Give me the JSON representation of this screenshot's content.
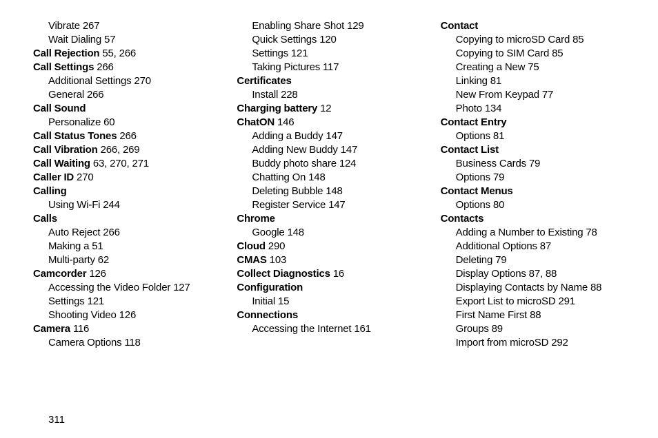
{
  "page_number": "311",
  "columns": [
    [
      {
        "level": 1,
        "bold": false,
        "text": "Vibrate",
        "pages": "267"
      },
      {
        "level": 1,
        "bold": false,
        "text": "Wait Dialing",
        "pages": "57"
      },
      {
        "level": 0,
        "bold": true,
        "text": "Call Rejection",
        "pages": "55, 266"
      },
      {
        "level": 0,
        "bold": true,
        "text": "Call Settings",
        "pages": "266"
      },
      {
        "level": 1,
        "bold": false,
        "text": "Additional Settings",
        "pages": "270"
      },
      {
        "level": 1,
        "bold": false,
        "text": "General",
        "pages": "266"
      },
      {
        "level": 0,
        "bold": true,
        "text": "Call Sound",
        "pages": ""
      },
      {
        "level": 1,
        "bold": false,
        "text": "Personalize",
        "pages": "60"
      },
      {
        "level": 0,
        "bold": true,
        "text": "Call Status Tones",
        "pages": "266"
      },
      {
        "level": 0,
        "bold": true,
        "text": "Call Vibration",
        "pages": "266, 269"
      },
      {
        "level": 0,
        "bold": true,
        "text": "Call Waiting",
        "pages": "63, 270, 271"
      },
      {
        "level": 0,
        "bold": true,
        "text": "Caller ID",
        "pages": "270"
      },
      {
        "level": 0,
        "bold": true,
        "text": "Calling",
        "pages": ""
      },
      {
        "level": 1,
        "bold": false,
        "text": "Using Wi-Fi",
        "pages": "244"
      },
      {
        "level": 0,
        "bold": true,
        "text": "Calls",
        "pages": ""
      },
      {
        "level": 1,
        "bold": false,
        "text": "Auto Reject",
        "pages": "266"
      },
      {
        "level": 1,
        "bold": false,
        "text": "Making a",
        "pages": "51"
      },
      {
        "level": 1,
        "bold": false,
        "text": "Multi-party",
        "pages": "62"
      },
      {
        "level": 0,
        "bold": true,
        "text": "Camcorder",
        "pages": "126"
      },
      {
        "level": 1,
        "bold": false,
        "text": "Accessing the Video Folder",
        "pages": "127"
      },
      {
        "level": 1,
        "bold": false,
        "text": "Settings",
        "pages": "121"
      },
      {
        "level": 1,
        "bold": false,
        "text": "Shooting Video",
        "pages": "126"
      },
      {
        "level": 0,
        "bold": true,
        "text": "Camera",
        "pages": "116"
      },
      {
        "level": 1,
        "bold": false,
        "text": "Camera Options",
        "pages": "118"
      }
    ],
    [
      {
        "level": 1,
        "bold": false,
        "text": "Enabling Share Shot",
        "pages": "129"
      },
      {
        "level": 1,
        "bold": false,
        "text": "Quick Settings",
        "pages": "120"
      },
      {
        "level": 1,
        "bold": false,
        "text": "Settings",
        "pages": "121"
      },
      {
        "level": 1,
        "bold": false,
        "text": "Taking Pictures",
        "pages": "117"
      },
      {
        "level": 0,
        "bold": true,
        "text": "Certificates",
        "pages": ""
      },
      {
        "level": 1,
        "bold": false,
        "text": "Install",
        "pages": "228"
      },
      {
        "level": 0,
        "bold": true,
        "text": "Charging battery",
        "pages": "12"
      },
      {
        "level": 0,
        "bold": true,
        "text": "ChatON",
        "pages": "146"
      },
      {
        "level": 1,
        "bold": false,
        "text": "Adding a Buddy",
        "pages": "147"
      },
      {
        "level": 1,
        "bold": false,
        "text": "Adding New Buddy",
        "pages": "147"
      },
      {
        "level": 1,
        "bold": false,
        "text": "Buddy photo share",
        "pages": "124"
      },
      {
        "level": 1,
        "bold": false,
        "text": "Chatting On",
        "pages": "148"
      },
      {
        "level": 1,
        "bold": false,
        "text": "Deleting Bubble",
        "pages": "148"
      },
      {
        "level": 1,
        "bold": false,
        "text": "Register Service",
        "pages": "147"
      },
      {
        "level": 0,
        "bold": true,
        "text": "Chrome",
        "pages": ""
      },
      {
        "level": 1,
        "bold": false,
        "text": "Google",
        "pages": "148"
      },
      {
        "level": 0,
        "bold": true,
        "text": "Cloud",
        "pages": "290"
      },
      {
        "level": 0,
        "bold": true,
        "text": "CMAS",
        "pages": "103"
      },
      {
        "level": 0,
        "bold": true,
        "text": "Collect Diagnostics",
        "pages": "16"
      },
      {
        "level": 0,
        "bold": true,
        "text": "Configuration",
        "pages": ""
      },
      {
        "level": 1,
        "bold": false,
        "text": "Initial",
        "pages": "15"
      },
      {
        "level": 0,
        "bold": true,
        "text": "Connections",
        "pages": ""
      },
      {
        "level": 1,
        "bold": false,
        "text": "Accessing the Internet",
        "pages": "161"
      }
    ],
    [
      {
        "level": 0,
        "bold": true,
        "text": "Contact",
        "pages": ""
      },
      {
        "level": 1,
        "bold": false,
        "text": "Copying to microSD Card",
        "pages": "85"
      },
      {
        "level": 1,
        "bold": false,
        "text": "Copying to SIM Card",
        "pages": "85"
      },
      {
        "level": 1,
        "bold": false,
        "text": "Creating a New",
        "pages": "75"
      },
      {
        "level": 1,
        "bold": false,
        "text": "Linking",
        "pages": "81"
      },
      {
        "level": 1,
        "bold": false,
        "text": "New From Keypad",
        "pages": "77"
      },
      {
        "level": 1,
        "bold": false,
        "text": "Photo",
        "pages": "134"
      },
      {
        "level": 0,
        "bold": true,
        "text": "Contact Entry",
        "pages": ""
      },
      {
        "level": 1,
        "bold": false,
        "text": "Options",
        "pages": "81"
      },
      {
        "level": 0,
        "bold": true,
        "text": "Contact List",
        "pages": ""
      },
      {
        "level": 1,
        "bold": false,
        "text": "Business Cards",
        "pages": "79"
      },
      {
        "level": 1,
        "bold": false,
        "text": "Options",
        "pages": "79"
      },
      {
        "level": 0,
        "bold": true,
        "text": "Contact Menus",
        "pages": ""
      },
      {
        "level": 1,
        "bold": false,
        "text": "Options",
        "pages": "80"
      },
      {
        "level": 0,
        "bold": true,
        "text": "Contacts",
        "pages": ""
      },
      {
        "level": 1,
        "bold": false,
        "text": "Adding a Number to Existing",
        "pages": "78"
      },
      {
        "level": 1,
        "bold": false,
        "text": "Additional Options",
        "pages": "87"
      },
      {
        "level": 1,
        "bold": false,
        "text": "Deleting",
        "pages": "79"
      },
      {
        "level": 1,
        "bold": false,
        "text": "Display Options",
        "pages": "87, 88"
      },
      {
        "level": 1,
        "bold": false,
        "text": "Displaying Contacts by Name",
        "pages": "88"
      },
      {
        "level": 1,
        "bold": false,
        "text": "Export List to microSD",
        "pages": "291"
      },
      {
        "level": 1,
        "bold": false,
        "text": "First Name First",
        "pages": "88"
      },
      {
        "level": 1,
        "bold": false,
        "text": "Groups",
        "pages": "89"
      },
      {
        "level": 1,
        "bold": false,
        "text": "Import from microSD",
        "pages": "292"
      }
    ]
  ]
}
